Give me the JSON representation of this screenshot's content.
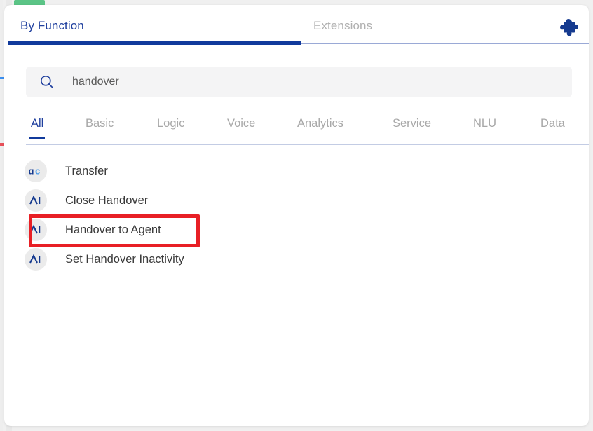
{
  "window": {
    "green_tab_stub": "",
    "panel_background": "#ffffff",
    "page_background": "#f0f0f0"
  },
  "top_tabs": {
    "items": [
      {
        "label": "By Function",
        "active": true
      },
      {
        "label": "Extensions",
        "active": false
      }
    ],
    "active_color": "#1f3f9e",
    "inactive_color": "#b0b0b0",
    "underline_color": "#113a9c",
    "extension_icon": "puzzle-piece-icon"
  },
  "search": {
    "icon": "search-icon",
    "value": "handover",
    "placeholder": "Search",
    "background": "#f4f4f5"
  },
  "category_tabs": {
    "items": [
      {
        "label": "All",
        "active": true
      },
      {
        "label": "Basic",
        "active": false
      },
      {
        "label": "Logic",
        "active": false
      },
      {
        "label": "Voice",
        "active": false
      },
      {
        "label": "Analytics",
        "active": false
      },
      {
        "label": "Service",
        "active": false
      },
      {
        "label": "NLU",
        "active": false
      },
      {
        "label": "Data",
        "active": false
      }
    ],
    "active_color": "#1f3f9e",
    "inactive_color": "#a8a8a8",
    "rule_color": "#c3cce4"
  },
  "results": {
    "items": [
      {
        "label": "Transfer",
        "icon": "alpha-c-logo-icon",
        "highlighted": false
      },
      {
        "label": "Close Handover",
        "icon": "lambda-i-logo-icon",
        "highlighted": false
      },
      {
        "label": "Handover to Agent",
        "icon": "lambda-i-logo-icon",
        "highlighted": true
      },
      {
        "label": "Set Handover Inactivity",
        "icon": "lambda-i-logo-icon",
        "highlighted": false
      }
    ],
    "label_color": "#3a3a3a",
    "icon_background": "#ebebeb",
    "icon_color": "#153a8f"
  },
  "annotation": {
    "highlight_color": "#e81f25",
    "target_label": "Handover to Agent"
  }
}
